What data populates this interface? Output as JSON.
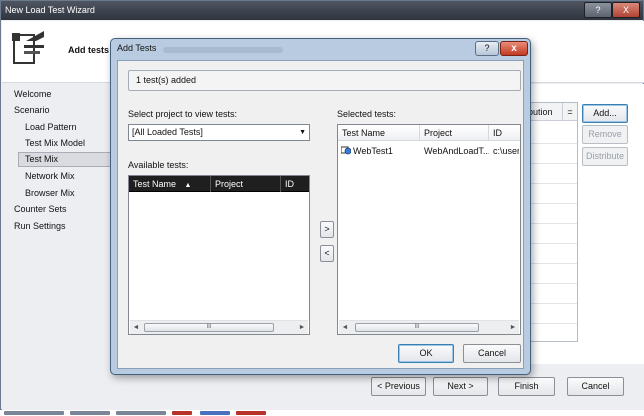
{
  "wizard": {
    "title": "New Load Test Wizard",
    "help_label": "?",
    "close_label": "X",
    "header_title": "Add tests t",
    "nav": [
      {
        "label": "Welcome"
      },
      {
        "label": "Scenario"
      },
      {
        "label": "Load Pattern"
      },
      {
        "label": "Test Mix Model"
      },
      {
        "label": "Test Mix",
        "selected": true
      },
      {
        "label": "Network Mix"
      },
      {
        "label": "Browser Mix"
      },
      {
        "label": "Counter Sets"
      },
      {
        "label": "Run Settings"
      }
    ],
    "mix_table": {
      "header": "bution",
      "sort_glyph": "="
    },
    "side_buttons": {
      "add": "Add...",
      "remove": "Remove",
      "distribute": "Distribute"
    },
    "footer_buttons": {
      "previous": "< Previous",
      "next": "Next >",
      "finish": "Finish",
      "cancel": "Cancel"
    }
  },
  "dialog": {
    "title": "Add Tests",
    "help_label": "?",
    "close_label": "x",
    "status": "1 test(s) added",
    "select_project_label": "Select project to view tests:",
    "select_project_value": "[All Loaded Tests]",
    "available_label": "Available tests:",
    "available_columns": [
      "Test Name",
      "Project",
      "ID"
    ],
    "sort_glyph": "▲",
    "selected_label": "Selected tests:",
    "selected_columns": [
      "Test Name",
      "Project",
      "ID"
    ],
    "selected_rows": [
      {
        "name": "WebTest1",
        "project": "WebAndLoadT...",
        "id": "c:\\user"
      }
    ],
    "move_right": ">",
    "move_left": "<",
    "scroll_thumb": "III",
    "ok": "OK",
    "cancel": "Cancel"
  },
  "colors": {
    "dialog_frame": "#b9cbe0",
    "title_bar": "#2f343d",
    "close_red": "#c23a23"
  }
}
